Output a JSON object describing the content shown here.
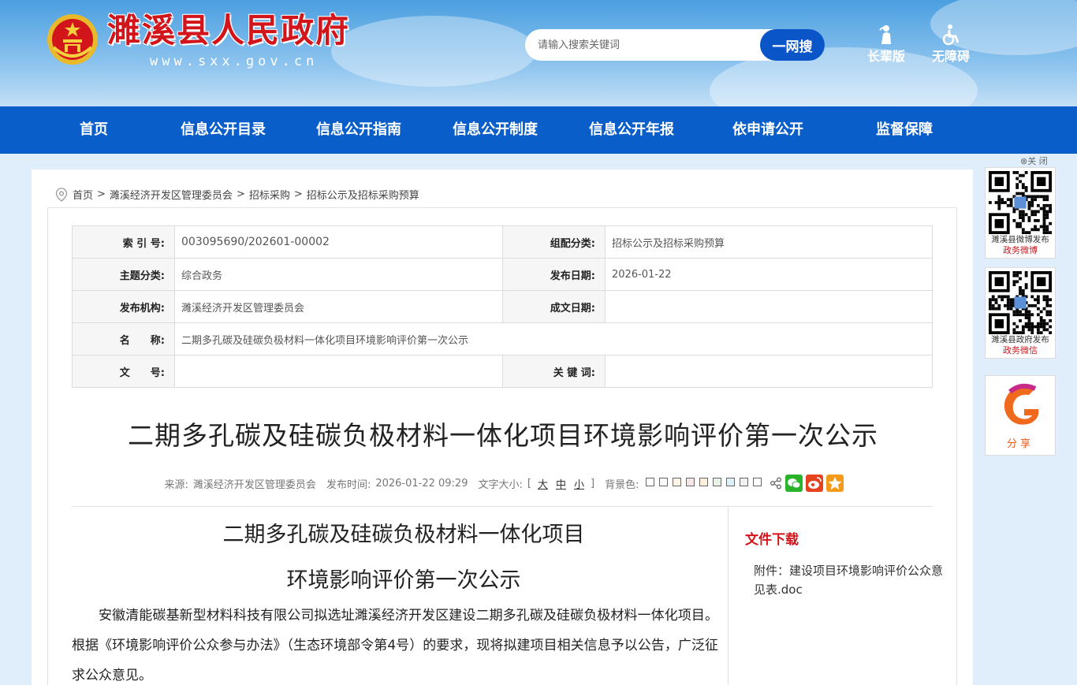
{
  "header": {
    "title": "濉溪县人民政府",
    "url": "www.sxx.gov.cn",
    "search_placeholder": "请输入搜索关键词",
    "search_button": "一网搜",
    "elder_mode": "长辈版",
    "accessibility": "无障碍"
  },
  "nav": [
    "首页",
    "信息公开目录",
    "信息公开指南",
    "信息公开制度",
    "信息公开年报",
    "依申请公开",
    "监督保障"
  ],
  "breadcrumb": [
    "首页",
    "濉溪经济开发区管理委员会",
    "招标采购",
    "招标公示及招标采购预算"
  ],
  "breadcrumb_sep": ">",
  "meta": {
    "index_label": "索 引 号:",
    "index_value": "003095690/202601-00002",
    "category_label": "组配分类:",
    "category_value": "招标公示及招标采购预算",
    "topic_label": "主题分类:",
    "topic_value": "综合政务",
    "pubdate_label": "发布日期:",
    "pubdate_value": "2026-01-22",
    "org_label": "发布机构:",
    "org_value": "濉溪经济开发区管理委员会",
    "written_label": "成文日期:",
    "written_value": "",
    "name_label": "名　　称:",
    "name_value": "二期多孔碳及硅碳负极材料一体化项目环境影响评价第一次公示",
    "docno_label": "文　　号:",
    "docno_value": "",
    "keyword_label": "关 键 词:",
    "keyword_value": ""
  },
  "article": {
    "title": "二期多孔碳及硅碳负极材料一体化项目环境影响评价第一次公示",
    "source_label": "来源:",
    "source": "濉溪经济开发区管理委员会",
    "time_label": "发布时间:",
    "time": "2026-01-22 09:29",
    "fontsize_label": "文字大小:",
    "fontsize_open": "[",
    "fontsize_close": "]",
    "size_large": "大",
    "size_medium": "中",
    "size_small": "小",
    "bg_label": "背景色:",
    "bg_colors": [
      "#ffffff",
      "#fafafa",
      "#fdf5e6",
      "#f5e6e6",
      "#fcefe0",
      "#e6f3e6",
      "#e0f0f8",
      "#f0f0f0",
      "#ffffff"
    ],
    "heading_line1": "二期多孔碳及硅碳负极材料一体化项目",
    "heading_line2": "环境影响评价第一次公示",
    "paragraph": "安徽清能碳基新型材料科技有限公司拟选址濉溪经济开发区建设二期多孔碳及硅碳负极材料一体化项目。根据《环境影响评价公众参与办法》（生态环境部令第4号）的要求，现将拟建项目相关信息予以公告，广泛征求公众意见。"
  },
  "downloads": {
    "title": "文件下载",
    "file": "附件：建设项目环境影响评价公众意见表.doc"
  },
  "float": {
    "close": "⊗关 闭",
    "weibo_l1": "濉溪县微博发布",
    "weibo_l2": "政务微博",
    "wechat_l1": "濉溪县政府发布",
    "wechat_l2": "政务微信",
    "share": "分享"
  },
  "colors": {
    "nav": "#0a5ec9",
    "accent_red": "#d2141b",
    "search_btn": "#0a56c9"
  }
}
